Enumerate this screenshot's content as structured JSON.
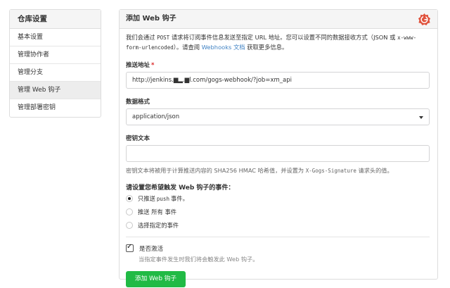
{
  "sidebar": {
    "title": "仓库设置",
    "items": [
      {
        "label": "基本设置"
      },
      {
        "label": "管理协作者"
      },
      {
        "label": "管理分支"
      },
      {
        "label": "管理 Web 钩子"
      },
      {
        "label": "管理部署密钥"
      }
    ]
  },
  "panel": {
    "title": "添加 Web 钩子",
    "desc": {
      "part1": "我们会通过 ",
      "method": "POST",
      "part2": " 请求将订阅事件信息发送至指定 URL 地址。您可以设置不同的数据接收方式（JSON 或 ",
      "format": "x-www-form-urlencoded",
      "part3": "）。请查阅 ",
      "link": "Webhooks 文档",
      "part4": " 获取更多信息。"
    },
    "url_label": "推送地址",
    "url_required": "*",
    "url_value": "http://jenkins.▆▂.▆l.com/gogs-webhook/?job=xm_api",
    "format_label": "数据格式",
    "format_value": "application/json",
    "secret_label": "密钥文本",
    "secret_value": "",
    "secret_help": {
      "part1": "密钥文本将被用于计算推送内容的 SHA256 HMAC 哈希值，并设置为 ",
      "header": "X-Gogs-Signature",
      "part2": " 请求头的值。"
    },
    "events_title": "请设置您希望触发 Web 钩子的事件：",
    "events": {
      "push_only": {
        "before": "只推送",
        "code": "push",
        "after": "事件。"
      },
      "all": "推送 所有 事件",
      "choose": "选择指定的事件"
    },
    "active_label": "是否激活",
    "active_help": "当指定事件发生时我们将会触发此 Web 钩子。",
    "submit_label": "添加 Web 钩子"
  },
  "colors": {
    "accent": "#21ba45",
    "link": "#4183c4",
    "logo": "#e0523c"
  }
}
